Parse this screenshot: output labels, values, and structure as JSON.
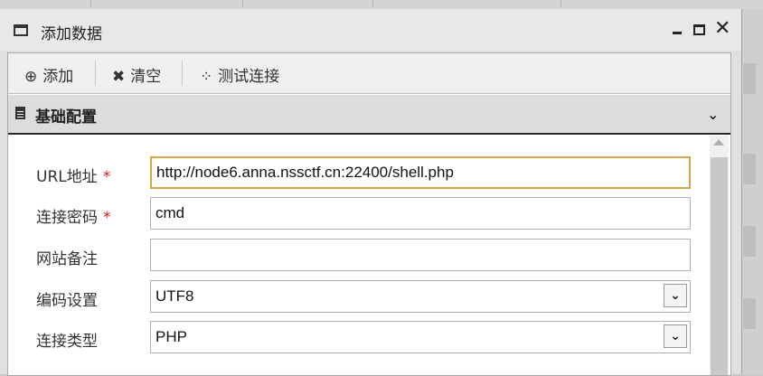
{
  "window": {
    "title": "添加数据",
    "title_icon": "window-icon",
    "controls": {
      "close_glyph": "✕"
    }
  },
  "toolbar": {
    "add_label": "添加",
    "add_icon": "⊕",
    "clear_label": "清空",
    "clear_icon": "✖",
    "test_label": "测试连接",
    "test_icon": "⁘"
  },
  "section": {
    "title": "基础配置",
    "chevron": "⌄"
  },
  "form": {
    "url": {
      "label": "URL地址",
      "required_mark": "*",
      "value": "http://node6.anna.nssctf.cn:22400/shell.php"
    },
    "password": {
      "label": "连接密码",
      "required_mark": "*",
      "value": "cmd"
    },
    "note": {
      "label": "网站备注",
      "value": ""
    },
    "encoding": {
      "label": "编码设置",
      "value": "UTF8"
    },
    "type": {
      "label": "连接类型",
      "value": "PHP"
    }
  },
  "colors": {
    "focus_border": "#d4a64a",
    "required": "#d42020"
  }
}
